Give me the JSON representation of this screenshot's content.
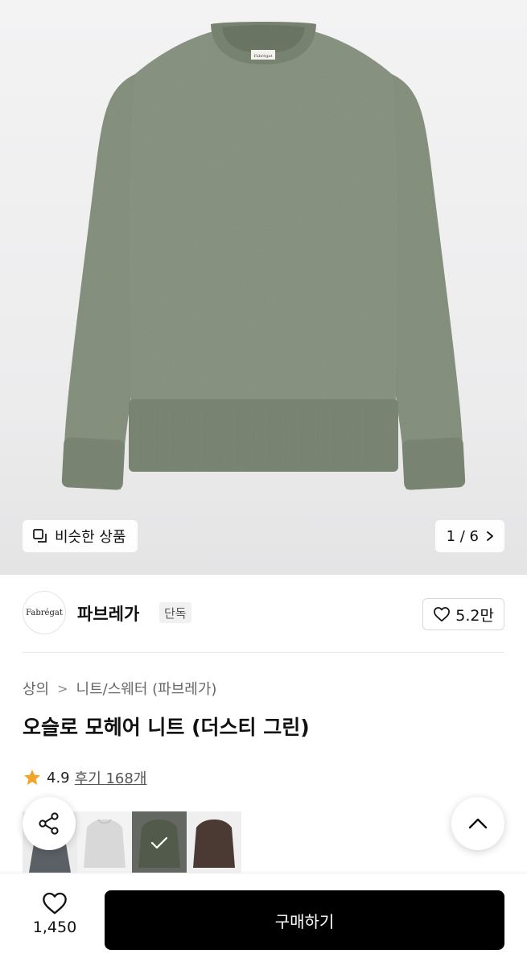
{
  "hero": {
    "similar_label": "비슷한 상품",
    "similar_icon": "similar-products-icon",
    "pager_text": "1 / 6",
    "pager_icon": "chevron-right-icon",
    "image_logo_text": "Fabrégat",
    "sweater_color": "#8a9582"
  },
  "brand": {
    "logo_text": "Fabrégat",
    "name": "파브레가",
    "badge": "단독",
    "like_count": "5.2만",
    "like_icon": "heart-outline-icon"
  },
  "breadcrumb": {
    "category": "상의",
    "separator": ">",
    "subcategory": "니트/스웨터 (파브레가)"
  },
  "product": {
    "title": "오슬로 모헤어 니트 (더스티 그린)",
    "rating": "4.9",
    "review_text": "후기 168개",
    "star_color": "#f2a42b"
  },
  "swatches": [
    {
      "name": "charcoal",
      "color": "#5b6066",
      "bg": "#eaeaea",
      "selected": false
    },
    {
      "name": "light-gray",
      "color": "#d9d9d9",
      "bg": "#f2f2f2",
      "selected": false
    },
    {
      "name": "dusty-green",
      "color": "#6e7a65",
      "bg": "#8c8e88",
      "selected": true
    },
    {
      "name": "brown",
      "color": "#4a3a33",
      "bg": "#eeeeee",
      "selected": false
    }
  ],
  "floating": {
    "share_icon": "share-icon",
    "top_icon": "chevron-up-icon"
  },
  "bottom_bar": {
    "wish_count": "1,450",
    "wish_icon": "heart-outline-icon",
    "buy_label": "구매하기"
  }
}
